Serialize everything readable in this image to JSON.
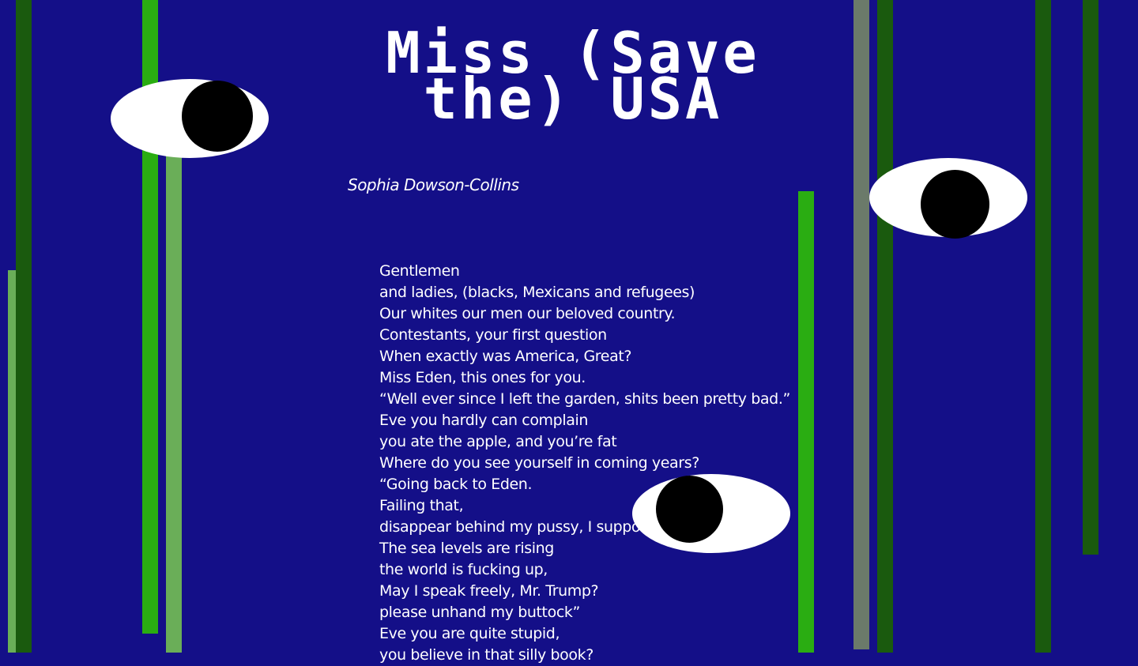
{
  "page": {
    "title": "Miss (Save the) USA",
    "author": "Sophia Dowson-Collins"
  },
  "colors": {
    "background": "#140f88",
    "bar_bright_green": "#2aad12",
    "bar_dark_green": "#1a5a0e",
    "bar_light_green": "#6aae58",
    "bar_grey": "#6b7a6a",
    "eye_white": "#ffffff",
    "pupil": "#000000",
    "text": "#ffffff"
  },
  "poem": {
    "lines": [
      "Gentlemen",
      "and ladies, (blacks, Mexicans and refugees)",
      "Our whites our men our beloved country.",
      "Contestants, your first question",
      "When exactly was America, Great?",
      "Miss Eden, this ones for you.",
      "“Well ever since I left the garden, shits been pretty bad.”",
      "Eve you hardly can complain",
      "you ate the apple, and you’re fat",
      "Where do you see yourself in coming years?",
      "“Going back to Eden.",
      "Failing that,",
      "disappear behind my pussy, I suppose.",
      "The sea levels are rising",
      "the world is fucking up,",
      "May I speak freely, Mr. Trump?",
      "please unhand my buttock”",
      "Eve you are quite stupid,",
      "you believe in that silly book?"
    ]
  }
}
